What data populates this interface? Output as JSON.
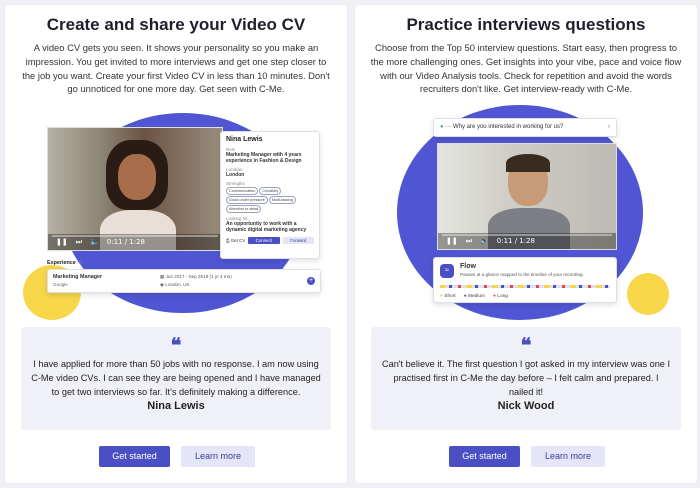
{
  "colors": {
    "accent": "#4b4fc4",
    "blob": "#5056d3",
    "yellow": "#f7d64a",
    "card_bg": "#ffffff",
    "quote_bg": "#f0f1f8"
  },
  "left": {
    "title": "Create and share your Video CV",
    "description": "A video CV gets you seen. It shows your personality so you make an impression. You get invited to more interviews and get one step closer to the job you want. Create your first Video CV in less than 10 minutes. Don't go unnoticed for one more day. Get seen with C-Me.",
    "video_time": "0:11 / 1:28",
    "profile": {
      "name": "Nina Lewis",
      "role_label": "Role",
      "role": "Marketing Manager with 4 years experience in Fashion & Design",
      "location_label": "Location",
      "location": "London",
      "strengths_label": "Strengths",
      "strengths": [
        "Communication",
        "Creativity",
        "Good under pressure",
        "Multi-tasking",
        "Attention to detail"
      ],
      "looking_label": "Looking for...",
      "looking": "An opportunity to work with a dynamic digital marketing agency",
      "get_cv": "Get CV",
      "connect": "Connect",
      "forward": "Forward"
    },
    "experience": {
      "label": "Experience",
      "title": "Marketing Manager",
      "company": "Google",
      "dates": "Jun 2017 - Sep 2018 (1 yr 4 mo)",
      "place": "London, UK"
    },
    "quote": "I have applied for more than 50 jobs with no response. I am now using C-Me video CVs. I can see they are being opened and I have managed to get two interviews so far. It's definitely making a difference.",
    "author": "Nina Lewis",
    "get_started": "Get started",
    "learn_more": "Learn more"
  },
  "right": {
    "title": "Practice interviews questions",
    "description": "Choose from the Top 50 interview questions. Start easy, then progress to the more challenging ones. Get insights into your vibe, pace and voice flow with our Video Analysis tools. Check for repetition and avoid the words recruiters don't like. Get interview-ready with C-Me.",
    "question": "Why are you interested in working for us?",
    "video_time": "0:11 / 1:28",
    "flow": {
      "title": "Flow",
      "description": "Pauses at a glance mapped to the timeline of your recording.",
      "legend": [
        "Short",
        "Medium",
        "Long"
      ]
    },
    "quote": "Can't believe it. The first question I got asked in my interview was one I practised first in C-Me the day before – I felt calm and prepared. I nailed it!",
    "author": "Nick Wood",
    "get_started": "Get started",
    "learn_more": "Learn more"
  }
}
